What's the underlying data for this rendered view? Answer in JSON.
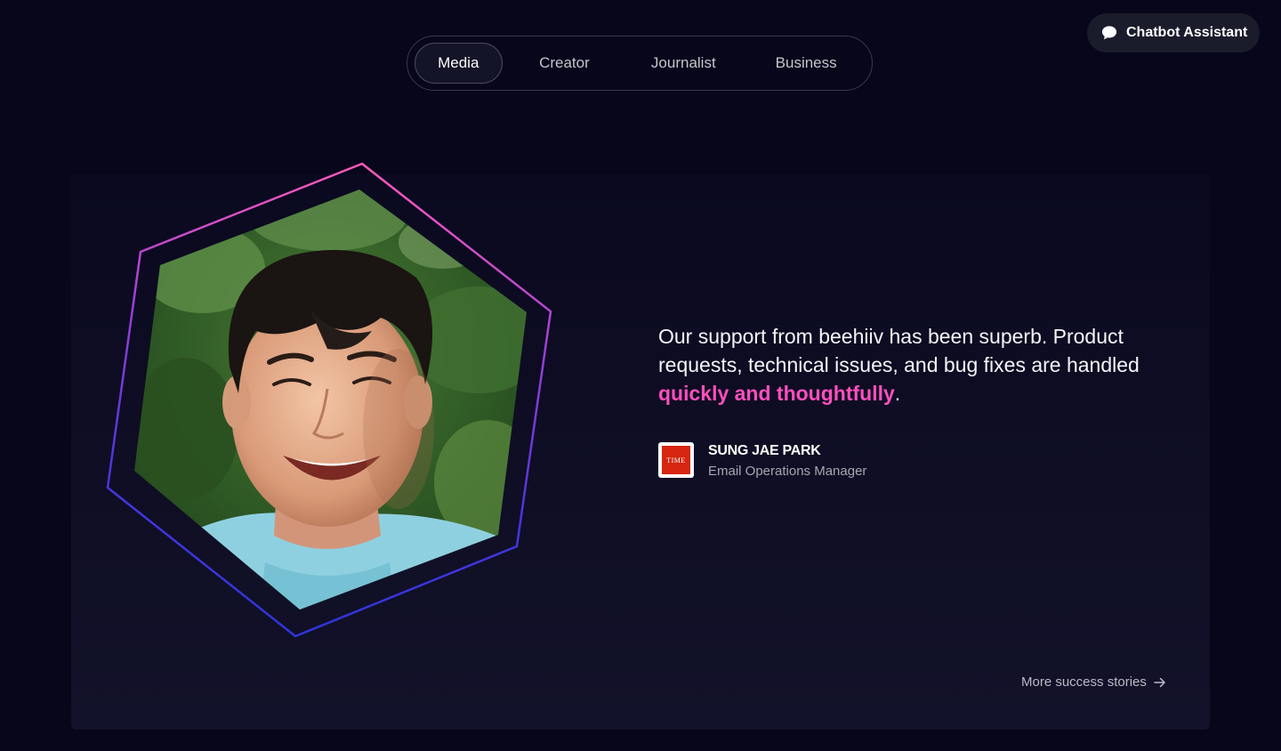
{
  "tabs": [
    {
      "label": "Media",
      "active": true
    },
    {
      "label": "Creator",
      "active": false
    },
    {
      "label": "Journalist",
      "active": false
    },
    {
      "label": "Business",
      "active": false
    }
  ],
  "chatbot": {
    "label": "Chatbot Assistant",
    "icon": "chat-bubble-icon"
  },
  "testimonial": {
    "quote_main": "Our support from beehiiv has been superb. Product requests, technical issues, and bug fixes are handled ",
    "quote_highlight": "quickly and thoughtfully",
    "quote_end": ".",
    "author_name": "SUNG JAE PARK",
    "author_role": "Email Operations Manager",
    "company_logo_text": "TIME"
  },
  "more_link": {
    "label": "More success stories",
    "icon": "arrow-right-icon"
  },
  "colors": {
    "background": "#07061a",
    "highlight": "#ff4fbd",
    "hex_gradient_top": "#ff5ab9",
    "hex_gradient_bottom": "#3236e6",
    "logo_red": "#d62610"
  }
}
